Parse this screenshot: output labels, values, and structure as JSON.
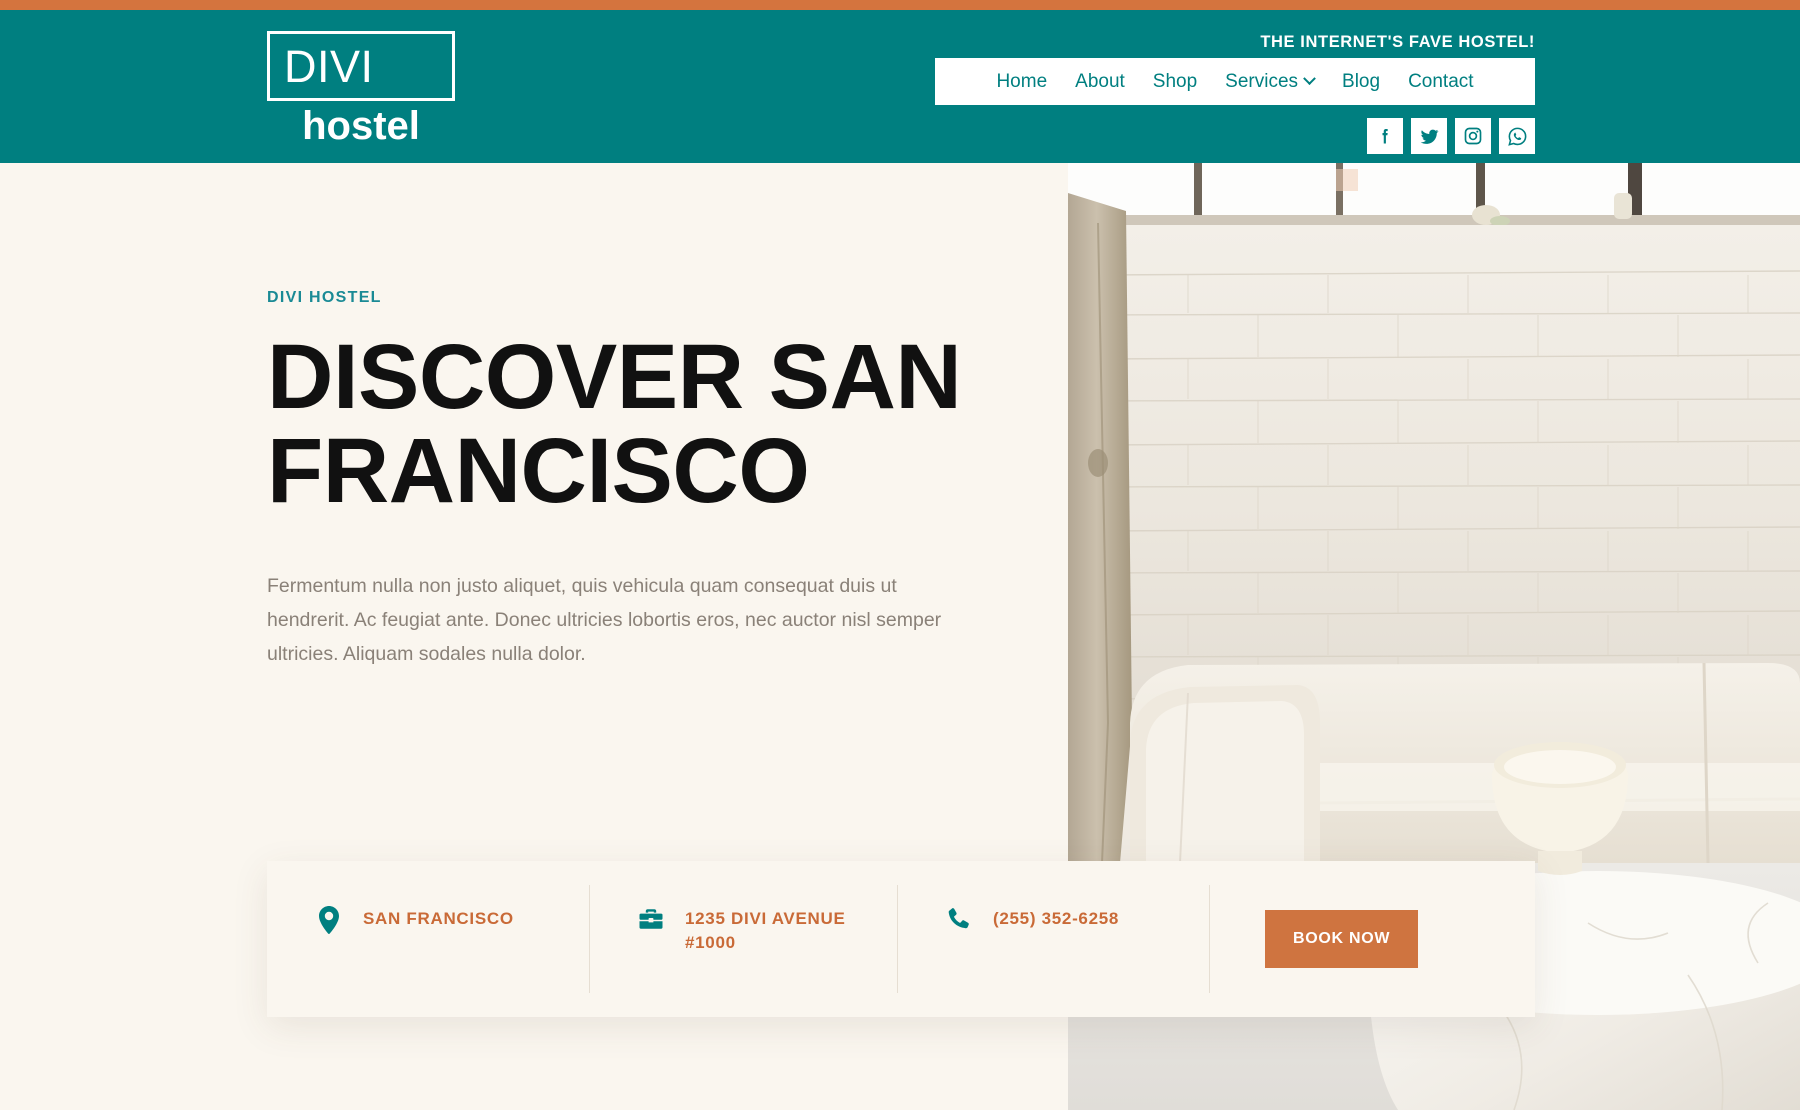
{
  "theme": {
    "accent_orange": "#d4743e",
    "teal": "#007f80",
    "cream": "#faf6ef",
    "eyebrow_teal": "#1a8a95",
    "info_text_orange": "#c96a37",
    "button_orange": "#cf7440"
  },
  "header": {
    "logo": {
      "word": "DIVI",
      "sub": "hostel"
    },
    "tagline": "THE INTERNET'S FAVE HOSTEL!",
    "nav": [
      {
        "label": "Home",
        "has_dropdown": false
      },
      {
        "label": "About",
        "has_dropdown": false
      },
      {
        "label": "Shop",
        "has_dropdown": false
      },
      {
        "label": "Services",
        "has_dropdown": true
      },
      {
        "label": "Blog",
        "has_dropdown": false
      },
      {
        "label": "Contact",
        "has_dropdown": false
      }
    ],
    "socials": [
      {
        "name": "facebook-icon",
        "label": "Facebook"
      },
      {
        "name": "twitter-icon",
        "label": "Twitter"
      },
      {
        "name": "instagram-icon",
        "label": "Instagram"
      },
      {
        "name": "whatsapp-icon",
        "label": "WhatsApp"
      }
    ]
  },
  "hero": {
    "eyebrow": "DIVI HOSTEL",
    "title": "DISCOVER SAN FRANCISCO",
    "paragraph": "Fermentum nulla non justo aliquet, quis vehicula quam consequat duis ut hendrerit. Ac feugiat ante. Donec ultricies lobortis eros, nec auctor nisl semper ultricies. Aliquam sodales nulla dolor.",
    "photo_alt": "Hostel lounge with white brick wall, cream sofa and marble table"
  },
  "info_bar": {
    "items": [
      {
        "icon": "map-pin-icon",
        "text": "SAN FRANCISCO"
      },
      {
        "icon": "briefcase-icon",
        "text": "1235 DIVI AVENUE #1000"
      },
      {
        "icon": "phone-icon",
        "text": "(255) 352-6258"
      }
    ],
    "book_label": "BOOK NOW"
  }
}
